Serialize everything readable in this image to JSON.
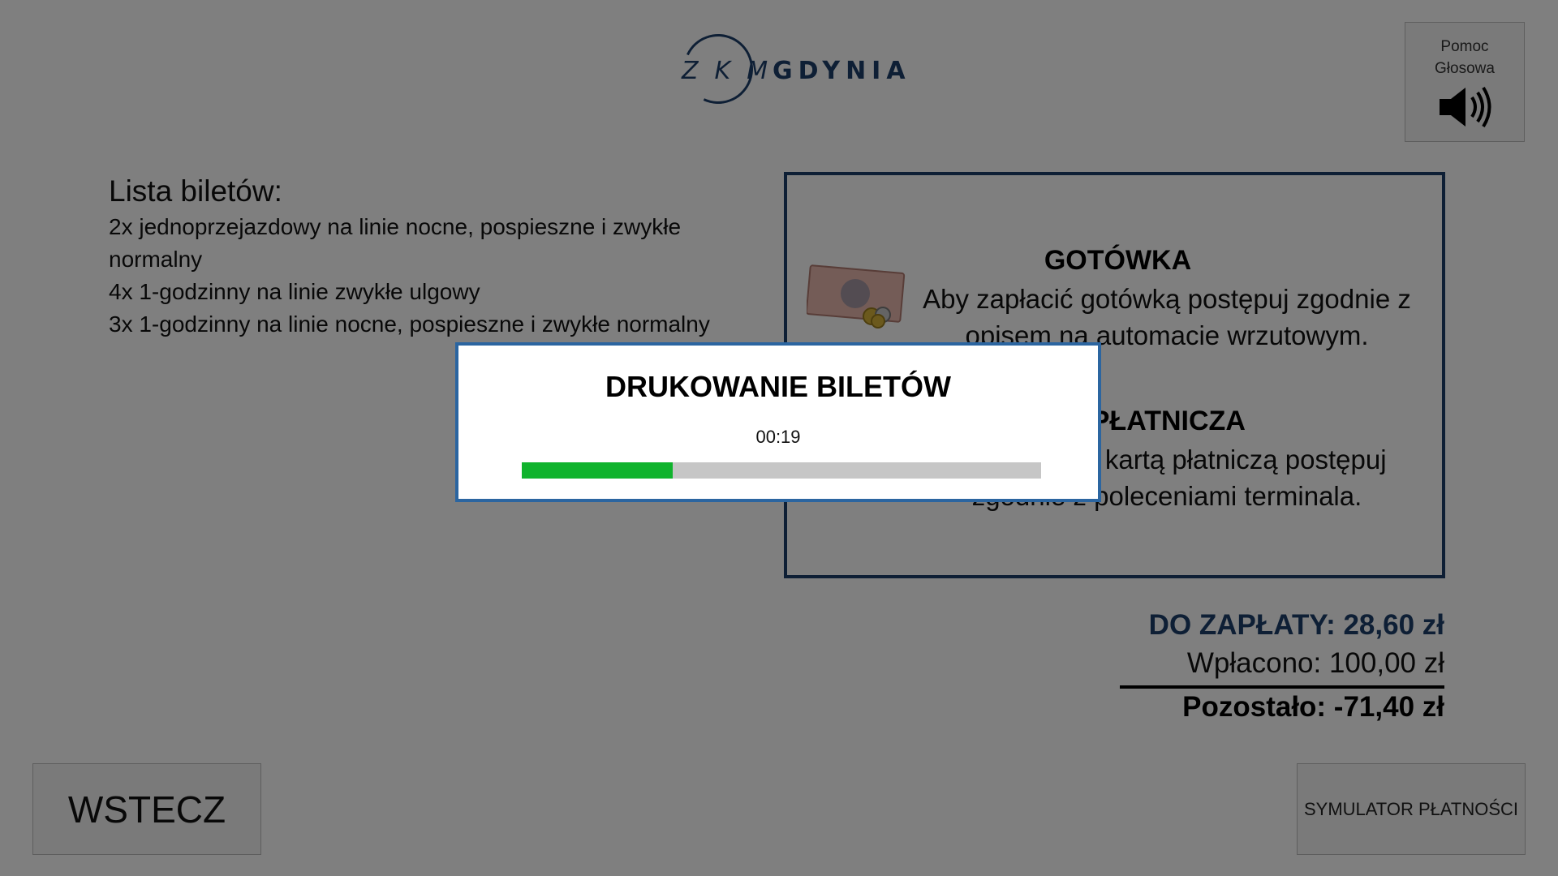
{
  "logo": {
    "brand": "ZKM",
    "city": "GDYNIA"
  },
  "voice_help": {
    "label": "Pomoc\nGłosowa",
    "icon": "speaker-icon"
  },
  "tickets": {
    "title": "Lista biletów:",
    "items": [
      "2x jednoprzejazdowy na linie nocne, pospieszne i zwykłe normalny",
      "4x 1-godzinny na linie zwykłe ulgowy",
      "3x 1-godzinny na linie nocne, pospieszne i zwykłe normalny"
    ]
  },
  "payment": {
    "cash": {
      "title": "GOTÓWKA",
      "description": "Aby zapłacić gotówką postępuj zgodnie z opisem na automacie wrzutowym.",
      "icon": "cash-icon"
    },
    "card": {
      "title": "KARTA PŁATNICZA",
      "description": "Aby zapłacić kartą płatniczą postępuj zgodnie z poleceniami terminala."
    }
  },
  "totals": {
    "due": "DO ZAPŁATY: 28,60 zł",
    "paid": "Wpłacono: 100,00 zł",
    "remaining": "Pozostało: -71,40 zł"
  },
  "buttons": {
    "back": "WSTECZ",
    "simulator": "SYMULATOR PŁATNOŚCI"
  },
  "modal": {
    "title": "DRUKOWANIE BILETÓW",
    "timer": "00:19",
    "progress": 0.29
  },
  "colors": {
    "brand": "#1d3f6a",
    "progress": "#10b32d",
    "modal_border": "#2b65a0"
  }
}
